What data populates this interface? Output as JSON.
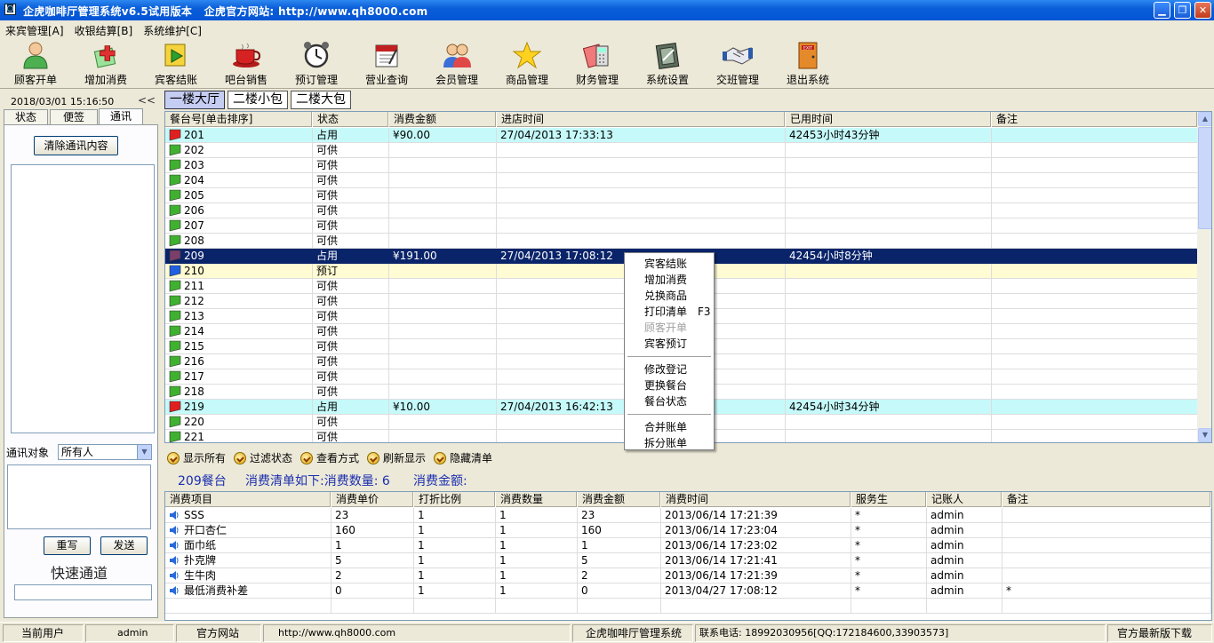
{
  "title": "企虎咖啡厅管理系统v6.5试用版本   企虎官方网站: http://www.qh8000.com",
  "menu": [
    "来宾管理[A]",
    "收银结算[B]",
    "系统维护[C]"
  ],
  "toolbar": [
    {
      "label": "顾客开单",
      "icon": "person-icon"
    },
    {
      "label": "增加消费",
      "icon": "add-icon"
    },
    {
      "label": "宾客结账",
      "icon": "checkout-icon"
    },
    {
      "label": "吧台销售",
      "icon": "coffee-cup-icon"
    },
    {
      "label": "预订管理",
      "icon": "alarm-clock-icon"
    },
    {
      "label": "营业查询",
      "icon": "calendar-icon"
    },
    {
      "label": "会员管理",
      "icon": "members-icon"
    },
    {
      "label": "商品管理",
      "icon": "star-icon"
    },
    {
      "label": "财务管理",
      "icon": "calculator-icon"
    },
    {
      "label": "系统设置",
      "icon": "settings-book-icon"
    },
    {
      "label": "交班管理",
      "icon": "handshake-icon"
    },
    {
      "label": "退出系统",
      "icon": "exit-door-icon"
    }
  ],
  "left": {
    "datetime": "2018/03/01  15:16:50",
    "collapse": "<<",
    "tabs": [
      "状态",
      "便签",
      "通讯"
    ],
    "clear_button": "清除通讯内容",
    "target_label": "通讯对象",
    "target_value": "所有人",
    "rewrite_button": "重写",
    "send_button": "发送",
    "fast_channel": "快速通道"
  },
  "area_tabs": [
    "一楼大厅",
    "二楼小包",
    "二楼大包"
  ],
  "tables": {
    "headers": [
      "餐台号[单击排序]",
      "状态",
      "消费金额",
      "进店时间",
      "已用时间",
      "备注"
    ],
    "rows": [
      {
        "no": "201",
        "status": "占用",
        "amount": "¥90.00",
        "time_in": "27/04/2013 17:33:13",
        "used": "42453小时43分钟",
        "note": "",
        "kind": "occ"
      },
      {
        "no": "202",
        "status": "可供",
        "amount": "",
        "time_in": "",
        "used": "",
        "note": "",
        "kind": "free"
      },
      {
        "no": "203",
        "status": "可供",
        "amount": "",
        "time_in": "",
        "used": "",
        "note": "",
        "kind": "free"
      },
      {
        "no": "204",
        "status": "可供",
        "amount": "",
        "time_in": "",
        "used": "",
        "note": "",
        "kind": "free"
      },
      {
        "no": "205",
        "status": "可供",
        "amount": "",
        "time_in": "",
        "used": "",
        "note": "",
        "kind": "free"
      },
      {
        "no": "206",
        "status": "可供",
        "amount": "",
        "time_in": "",
        "used": "",
        "note": "",
        "kind": "free"
      },
      {
        "no": "207",
        "status": "可供",
        "amount": "",
        "time_in": "",
        "used": "",
        "note": "",
        "kind": "free"
      },
      {
        "no": "208",
        "status": "可供",
        "amount": "",
        "time_in": "",
        "used": "",
        "note": "",
        "kind": "free"
      },
      {
        "no": "209",
        "status": "占用",
        "amount": "¥191.00",
        "time_in": "27/04/2013 17:08:12",
        "used": "42454小时8分钟",
        "note": "",
        "kind": "sel"
      },
      {
        "no": "210",
        "status": "预订",
        "amount": "",
        "time_in": "",
        "used": "",
        "note": "",
        "kind": "res"
      },
      {
        "no": "211",
        "status": "可供",
        "amount": "",
        "time_in": "",
        "used": "",
        "note": "",
        "kind": "free"
      },
      {
        "no": "212",
        "status": "可供",
        "amount": "",
        "time_in": "",
        "used": "",
        "note": "",
        "kind": "free"
      },
      {
        "no": "213",
        "status": "可供",
        "amount": "",
        "time_in": "",
        "used": "",
        "note": "",
        "kind": "free"
      },
      {
        "no": "214",
        "status": "可供",
        "amount": "",
        "time_in": "",
        "used": "",
        "note": "",
        "kind": "free"
      },
      {
        "no": "215",
        "status": "可供",
        "amount": "",
        "time_in": "",
        "used": "",
        "note": "",
        "kind": "free"
      },
      {
        "no": "216",
        "status": "可供",
        "amount": "",
        "time_in": "",
        "used": "",
        "note": "",
        "kind": "free"
      },
      {
        "no": "217",
        "status": "可供",
        "amount": "",
        "time_in": "",
        "used": "",
        "note": "",
        "kind": "free"
      },
      {
        "no": "218",
        "status": "可供",
        "amount": "",
        "time_in": "",
        "used": "",
        "note": "",
        "kind": "free"
      },
      {
        "no": "219",
        "status": "占用",
        "amount": "¥10.00",
        "time_in": "27/04/2013 16:42:13",
        "used": "42454小时34分钟",
        "note": "",
        "kind": "occ"
      },
      {
        "no": "220",
        "status": "可供",
        "amount": "",
        "time_in": "",
        "used": "",
        "note": "",
        "kind": "free"
      },
      {
        "no": "221",
        "status": "可供",
        "amount": "",
        "time_in": "",
        "used": "",
        "note": "",
        "kind": "free"
      }
    ]
  },
  "context_menu": [
    {
      "label": "宾客结账"
    },
    {
      "label": "增加消费"
    },
    {
      "label": "兑换商品"
    },
    {
      "label": "打印清单",
      "shortcut": "F3"
    },
    {
      "label": "顾客开单",
      "disabled": true
    },
    {
      "label": "宾客预订"
    },
    {
      "sep": true
    },
    {
      "label": "修改登记"
    },
    {
      "label": "更换餐台"
    },
    {
      "label": "餐台状态"
    },
    {
      "sep": true
    },
    {
      "label": "合并账单"
    },
    {
      "label": "拆分账单"
    }
  ],
  "actions": [
    "显示所有",
    "过滤状态",
    "查看方式",
    "刷新显示",
    "隐藏清单"
  ],
  "summary": {
    "table": "209餐台",
    "list_title": "消费清单如下:消费数量: 6",
    "total": "消费金额:"
  },
  "consumption": {
    "headers": [
      "消费项目",
      "消费单价",
      "打折比例",
      "消费数量",
      "消费金额",
      "消费时间",
      "服务生",
      "记账人",
      "备注"
    ],
    "rows": [
      [
        "SSS",
        "23",
        "1",
        "1",
        "23",
        "2013/06/14 17:21:39",
        "*",
        "admin",
        ""
      ],
      [
        "开口杏仁",
        "160",
        "1",
        "1",
        "160",
        "2013/06/14 17:23:04",
        "*",
        "admin",
        ""
      ],
      [
        "面巾纸",
        "1",
        "1",
        "1",
        "1",
        "2013/06/14 17:23:02",
        "*",
        "admin",
        ""
      ],
      [
        "扑克牌",
        "5",
        "1",
        "1",
        "5",
        "2013/06/14 17:21:41",
        "*",
        "admin",
        ""
      ],
      [
        "生牛肉",
        "2",
        "1",
        "1",
        "2",
        "2013/06/14 17:21:39",
        "*",
        "admin",
        ""
      ],
      [
        "最低消费补差",
        "0",
        "1",
        "1",
        "0",
        "2013/04/27 17:08:12",
        "*",
        "admin",
        "*"
      ]
    ]
  },
  "status_bar": [
    "当前用户",
    "admin",
    "官方网站",
    "http://www.qh8000.com",
    "企虎咖啡厅管理系统",
    "联系电话: 18992030956[QQ:172184600,33903573]",
    "官方最新版下载"
  ],
  "colors": {
    "title_bar": "#0a5ed8",
    "selected_row": "#0a246a",
    "occupied_row": "#c6fafa",
    "reserved_row": "#fffbd2",
    "summary_text": "#1b2fb0"
  }
}
